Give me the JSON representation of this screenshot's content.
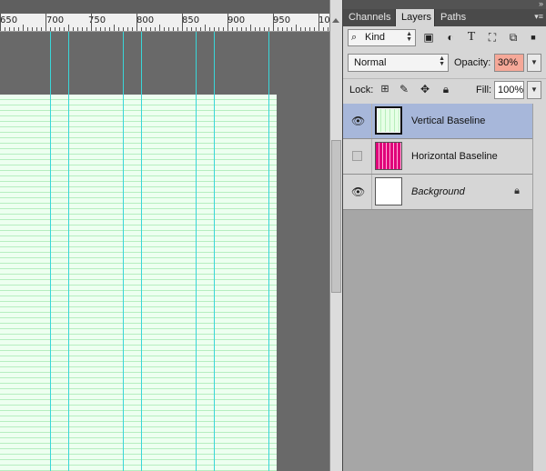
{
  "ruler": {
    "labels": [
      "650",
      "700",
      "750",
      "800",
      "850",
      "900",
      "950",
      "10"
    ]
  },
  "panel": {
    "tabs": [
      {
        "label": "Channels",
        "active": false
      },
      {
        "label": "Layers",
        "active": true
      },
      {
        "label": "Paths",
        "active": false
      }
    ],
    "filter": {
      "kind_label": "Kind",
      "icons": [
        "image-filter-icon",
        "adjustment-filter-icon",
        "type-filter-icon",
        "shape-filter-icon",
        "smart-object-filter-icon"
      ]
    },
    "blend_mode": "Normal",
    "opacity_label": "Opacity:",
    "opacity_value": "30%",
    "lock_label": "Lock:",
    "fill_label": "Fill:",
    "fill_value": "100%",
    "layers": [
      {
        "name": "Vertical Baseline",
        "visible": true,
        "selected": true,
        "italic": false,
        "thumb_color": "#e6ffe6"
      },
      {
        "name": "Horizontal Baseline",
        "visible": false,
        "selected": false,
        "italic": false,
        "thumb_color": "#e0007a"
      },
      {
        "name": "Background",
        "visible": true,
        "selected": false,
        "italic": true,
        "thumb_color": "#ffffff",
        "locked": true
      }
    ]
  },
  "colors": {
    "guide": "#39d6d9",
    "selected_layer": "#a7b7da",
    "opacity_highlight": "#f5a898"
  }
}
